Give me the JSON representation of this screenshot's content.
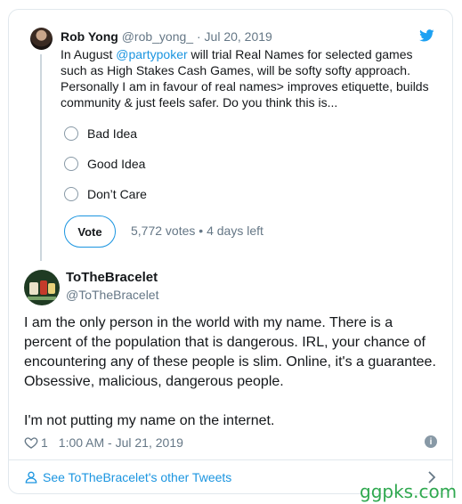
{
  "quoted": {
    "name": "Rob Yong",
    "handle": "@rob_yong_",
    "separator": "·",
    "date": "Jul 20, 2019",
    "text_before": "In August ",
    "mention": "@partypoker",
    "text_after": " will trial Real Names for selected games such as High Stakes Cash Games, will be softy softy approach. Personally I am in favour of real names> improves etiquette, builds community & just feels safer. Do you think this is...",
    "poll": {
      "options": [
        "Bad Idea",
        "Good Idea",
        "Don’t Care"
      ],
      "vote_label": "Vote",
      "votes": "5,772 votes",
      "separator": "•",
      "time_left": "4 days left"
    }
  },
  "tweet": {
    "name": "ToTheBracelet",
    "handle": "@ToTheBracelet",
    "text": "I am the only person in the world with my name. There is a percent of the population that is dangerous. IRL, your chance of encountering any of these people is slim. Online, it's a guarantee. Obsessive, malicious, dangerous people.\n\nI'm not putting my name on the internet.",
    "likes": "1",
    "timestamp": "1:00 AM - Jul 21, 2019",
    "info_glyph": "i"
  },
  "footer": {
    "see_more": "See ToTheBracelet's other Tweets"
  },
  "watermark": "ggpks.com",
  "colors": {
    "accent": "#1b95e0",
    "text": "#14171a",
    "muted": "#657786",
    "border": "#e1e8ed",
    "watermark": "#2fa84f"
  }
}
